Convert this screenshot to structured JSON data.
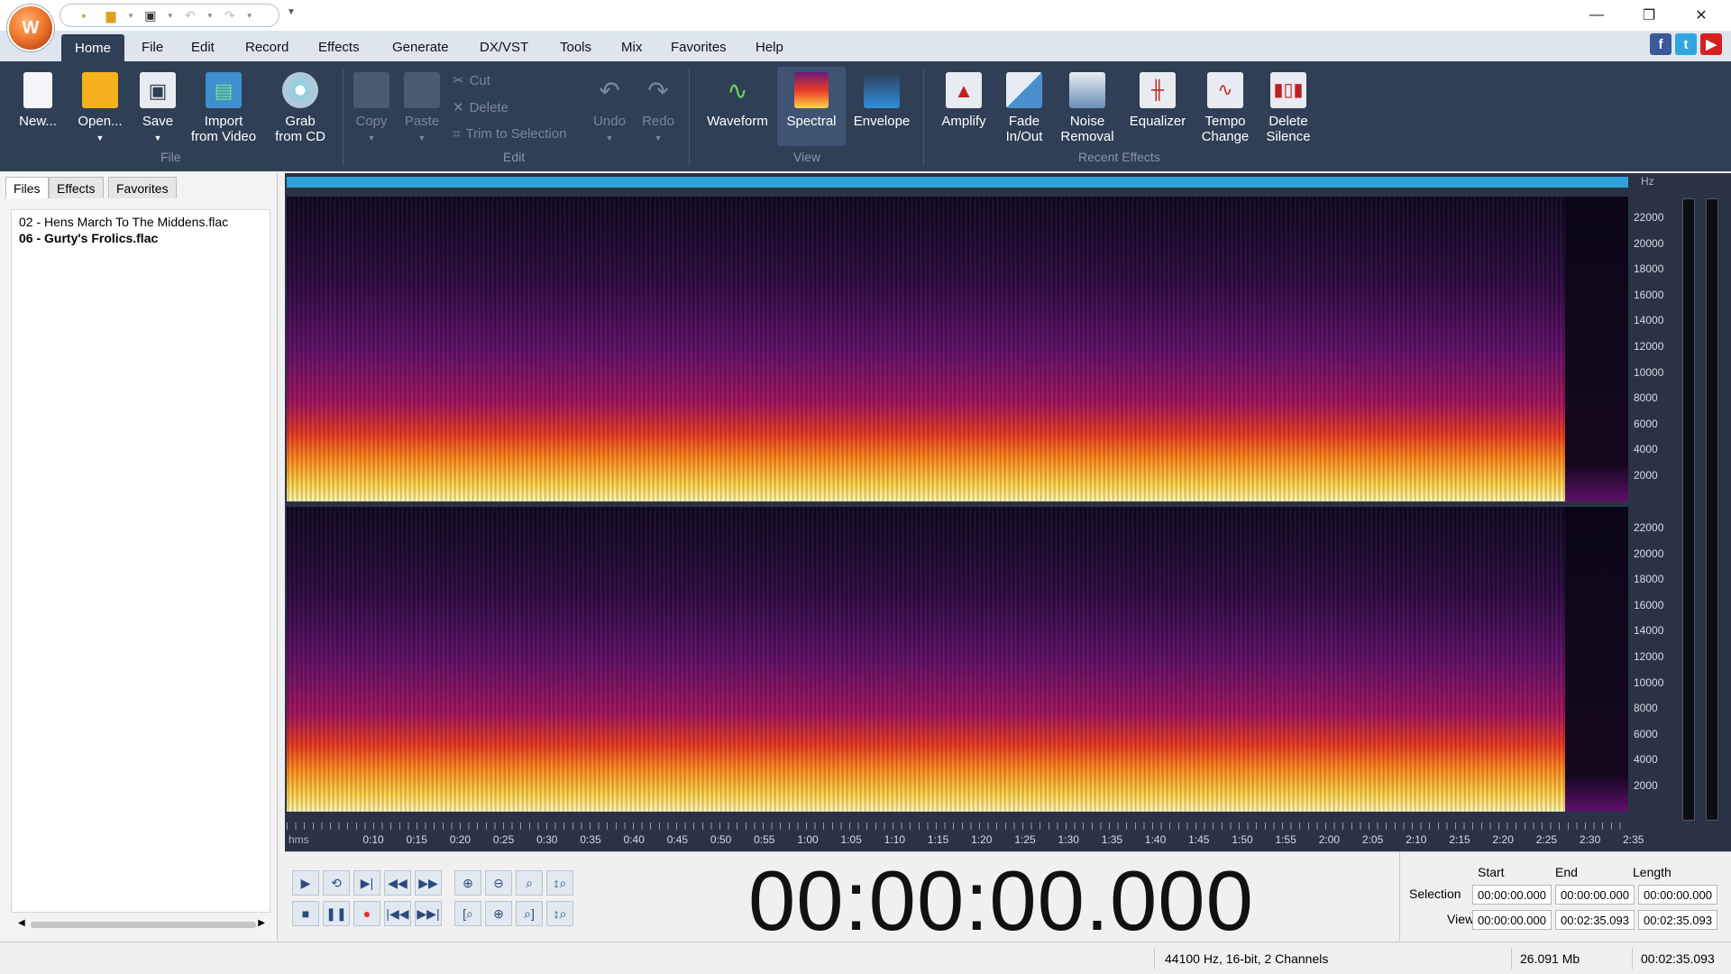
{
  "titlebar": {
    "qat_icons": [
      "new-file-icon",
      "open-folder-icon",
      "save-icon",
      "undo-icon",
      "redo-icon"
    ]
  },
  "menu": [
    "Home",
    "File",
    "Edit",
    "Record",
    "Effects",
    "Generate",
    "DX/VST",
    "Tools",
    "Mix",
    "Favorites",
    "Help"
  ],
  "social": {
    "facebook": "f",
    "twitter": "t",
    "youtube": "▶"
  },
  "ribbon": {
    "file": {
      "new": "New...",
      "open": "Open...",
      "save": "Save",
      "import_line1": "Import",
      "import_line2": "from Video",
      "grab_line1": "Grab",
      "grab_line2": "from CD",
      "group": "File"
    },
    "edit": {
      "copy": "Copy",
      "paste": "Paste",
      "cut": "Cut",
      "delete": "Delete",
      "trim": "Trim to Selection",
      "undo": "Undo",
      "redo": "Redo",
      "group": "Edit"
    },
    "view": {
      "waveform": "Waveform",
      "spectral": "Spectral",
      "envelope": "Envelope",
      "group": "View"
    },
    "effects": {
      "amplify": "Amplify",
      "fade_line1": "Fade",
      "fade_line2": "In/Out",
      "noise_line1": "Noise",
      "noise_line2": "Removal",
      "equalizer": "Equalizer",
      "tempo_line1": "Tempo",
      "tempo_line2": "Change",
      "silence_line1": "Delete",
      "silence_line2": "Silence",
      "group": "Recent Effects"
    }
  },
  "panel": {
    "tabs": [
      "Files",
      "Effects",
      "Favorites"
    ],
    "files": [
      "02 - Hens March To The Middens.flac",
      "06 - Gurty's Frolics.flac"
    ]
  },
  "editor": {
    "hz_unit": "Hz",
    "hz_ticks": [
      "22000",
      "20000",
      "18000",
      "16000",
      "14000",
      "12000",
      "10000",
      "8000",
      "6000",
      "4000",
      "2000"
    ],
    "time_unit": "hms",
    "time_ticks": [
      "0:10",
      "0:15",
      "0:20",
      "0:25",
      "0:30",
      "0:35",
      "0:40",
      "0:45",
      "0:50",
      "0:55",
      "1:00",
      "1:05",
      "1:10",
      "1:15",
      "1:20",
      "1:25",
      "1:30",
      "1:35",
      "1:40",
      "1:45",
      "1:50",
      "1:55",
      "2:00",
      "2:05",
      "2:10",
      "2:15",
      "2:20",
      "2:25",
      "2:30",
      "2:35"
    ]
  },
  "transport": {
    "time": "00:00:00.000",
    "selection": {
      "headers": {
        "start": "Start",
        "end": "End",
        "length": "Length"
      },
      "selection_label": "Selection",
      "view_label": "View",
      "selection_values": [
        "00:00:00.000",
        "00:00:00.000",
        "00:00:00.000"
      ],
      "view_values": [
        "00:00:00.000",
        "00:02:35.093",
        "00:02:35.093"
      ]
    }
  },
  "status": {
    "format": "44100 Hz, 16-bit, 2 Channels",
    "size": "26.091 Mb",
    "duration": "00:02:35.093"
  }
}
